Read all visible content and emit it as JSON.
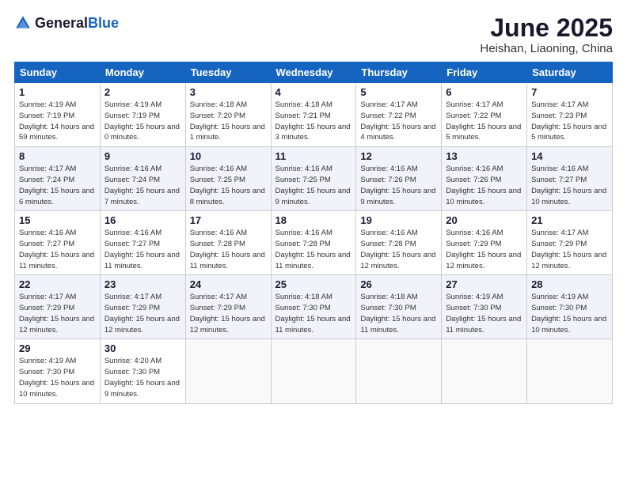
{
  "logo": {
    "general": "General",
    "blue": "Blue"
  },
  "title": "June 2025",
  "subtitle": "Heishan, Liaoning, China",
  "days_of_week": [
    "Sunday",
    "Monday",
    "Tuesday",
    "Wednesday",
    "Thursday",
    "Friday",
    "Saturday"
  ],
  "weeks": [
    [
      {
        "day": "1",
        "sunrise": "4:19 AM",
        "sunset": "7:19 PM",
        "daylight": "14 hours and 59 minutes."
      },
      {
        "day": "2",
        "sunrise": "4:19 AM",
        "sunset": "7:19 PM",
        "daylight": "15 hours and 0 minutes."
      },
      {
        "day": "3",
        "sunrise": "4:18 AM",
        "sunset": "7:20 PM",
        "daylight": "15 hours and 1 minute."
      },
      {
        "day": "4",
        "sunrise": "4:18 AM",
        "sunset": "7:21 PM",
        "daylight": "15 hours and 3 minutes."
      },
      {
        "day": "5",
        "sunrise": "4:17 AM",
        "sunset": "7:22 PM",
        "daylight": "15 hours and 4 minutes."
      },
      {
        "day": "6",
        "sunrise": "4:17 AM",
        "sunset": "7:22 PM",
        "daylight": "15 hours and 5 minutes."
      },
      {
        "day": "7",
        "sunrise": "4:17 AM",
        "sunset": "7:23 PM",
        "daylight": "15 hours and 5 minutes."
      }
    ],
    [
      {
        "day": "8",
        "sunrise": "4:17 AM",
        "sunset": "7:24 PM",
        "daylight": "15 hours and 6 minutes."
      },
      {
        "day": "9",
        "sunrise": "4:16 AM",
        "sunset": "7:24 PM",
        "daylight": "15 hours and 7 minutes."
      },
      {
        "day": "10",
        "sunrise": "4:16 AM",
        "sunset": "7:25 PM",
        "daylight": "15 hours and 8 minutes."
      },
      {
        "day": "11",
        "sunrise": "4:16 AM",
        "sunset": "7:25 PM",
        "daylight": "15 hours and 9 minutes."
      },
      {
        "day": "12",
        "sunrise": "4:16 AM",
        "sunset": "7:26 PM",
        "daylight": "15 hours and 9 minutes."
      },
      {
        "day": "13",
        "sunrise": "4:16 AM",
        "sunset": "7:26 PM",
        "daylight": "15 hours and 10 minutes."
      },
      {
        "day": "14",
        "sunrise": "4:16 AM",
        "sunset": "7:27 PM",
        "daylight": "15 hours and 10 minutes."
      }
    ],
    [
      {
        "day": "15",
        "sunrise": "4:16 AM",
        "sunset": "7:27 PM",
        "daylight": "15 hours and 11 minutes."
      },
      {
        "day": "16",
        "sunrise": "4:16 AM",
        "sunset": "7:27 PM",
        "daylight": "15 hours and 11 minutes."
      },
      {
        "day": "17",
        "sunrise": "4:16 AM",
        "sunset": "7:28 PM",
        "daylight": "15 hours and 11 minutes."
      },
      {
        "day": "18",
        "sunrise": "4:16 AM",
        "sunset": "7:28 PM",
        "daylight": "15 hours and 11 minutes."
      },
      {
        "day": "19",
        "sunrise": "4:16 AM",
        "sunset": "7:28 PM",
        "daylight": "15 hours and 12 minutes."
      },
      {
        "day": "20",
        "sunrise": "4:16 AM",
        "sunset": "7:29 PM",
        "daylight": "15 hours and 12 minutes."
      },
      {
        "day": "21",
        "sunrise": "4:17 AM",
        "sunset": "7:29 PM",
        "daylight": "15 hours and 12 minutes."
      }
    ],
    [
      {
        "day": "22",
        "sunrise": "4:17 AM",
        "sunset": "7:29 PM",
        "daylight": "15 hours and 12 minutes."
      },
      {
        "day": "23",
        "sunrise": "4:17 AM",
        "sunset": "7:29 PM",
        "daylight": "15 hours and 12 minutes."
      },
      {
        "day": "24",
        "sunrise": "4:17 AM",
        "sunset": "7:29 PM",
        "daylight": "15 hours and 12 minutes."
      },
      {
        "day": "25",
        "sunrise": "4:18 AM",
        "sunset": "7:30 PM",
        "daylight": "15 hours and 11 minutes."
      },
      {
        "day": "26",
        "sunrise": "4:18 AM",
        "sunset": "7:30 PM",
        "daylight": "15 hours and 11 minutes."
      },
      {
        "day": "27",
        "sunrise": "4:19 AM",
        "sunset": "7:30 PM",
        "daylight": "15 hours and 11 minutes."
      },
      {
        "day": "28",
        "sunrise": "4:19 AM",
        "sunset": "7:30 PM",
        "daylight": "15 hours and 10 minutes."
      }
    ],
    [
      {
        "day": "29",
        "sunrise": "4:19 AM",
        "sunset": "7:30 PM",
        "daylight": "15 hours and 10 minutes."
      },
      {
        "day": "30",
        "sunrise": "4:20 AM",
        "sunset": "7:30 PM",
        "daylight": "15 hours and 9 minutes."
      },
      null,
      null,
      null,
      null,
      null
    ]
  ],
  "labels": {
    "sunrise": "Sunrise:",
    "sunset": "Sunset:",
    "daylight": "Daylight:"
  }
}
